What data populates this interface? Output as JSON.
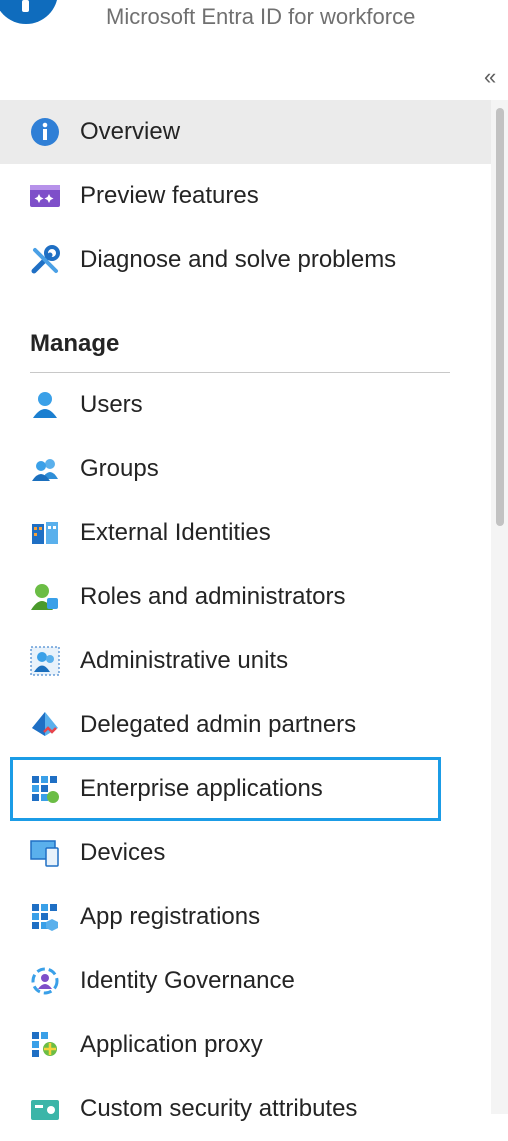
{
  "header": {
    "subtitle": "Microsoft Entra ID for workforce",
    "collapse_glyph": "«"
  },
  "nav": {
    "top_items": [
      {
        "label": "Overview",
        "icon": "info-icon",
        "selected": true
      },
      {
        "label": "Preview features",
        "icon": "preview-features-icon"
      },
      {
        "label": "Diagnose and solve problems",
        "icon": "wrench-icon"
      }
    ],
    "section_title": "Manage",
    "manage_items": [
      {
        "label": "Users",
        "icon": "user-icon"
      },
      {
        "label": "Groups",
        "icon": "groups-icon"
      },
      {
        "label": "External Identities",
        "icon": "external-identities-icon"
      },
      {
        "label": "Roles and administrators",
        "icon": "roles-icon"
      },
      {
        "label": "Administrative units",
        "icon": "admin-units-icon"
      },
      {
        "label": "Delegated admin partners",
        "icon": "delegated-partners-icon"
      },
      {
        "label": "Enterprise applications",
        "icon": "enterprise-apps-icon",
        "focused": true
      },
      {
        "label": "Devices",
        "icon": "devices-icon"
      },
      {
        "label": "App registrations",
        "icon": "app-registrations-icon"
      },
      {
        "label": "Identity Governance",
        "icon": "identity-governance-icon"
      },
      {
        "label": "Application proxy",
        "icon": "app-proxy-icon"
      },
      {
        "label": "Custom security attributes",
        "icon": "custom-attributes-icon"
      }
    ]
  },
  "colors": {
    "accent": "#0f6cbd",
    "focus_outline": "#1b9ce6",
    "selected_bg": "#ebebeb"
  }
}
